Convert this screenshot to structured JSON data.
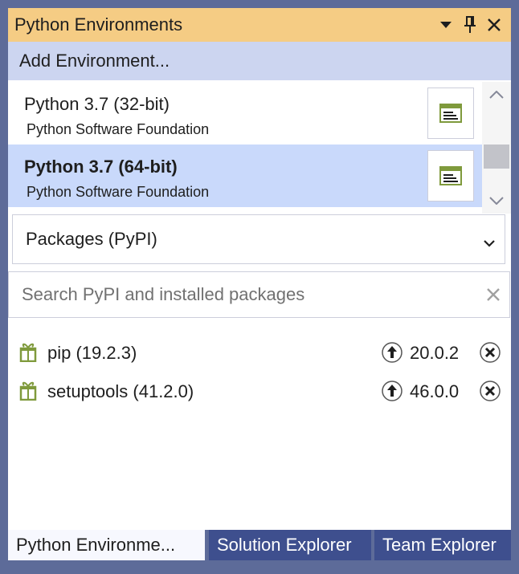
{
  "window": {
    "title": "Python Environments",
    "dropdown_icon": "triangle-down-icon",
    "pin_icon": "pin-icon",
    "close_icon": "close-icon"
  },
  "add_environment": {
    "label": "Add Environment..."
  },
  "environments": [
    {
      "name": "Python 3.7 (32-bit)",
      "vendor": "Python Software Foundation",
      "selected": false
    },
    {
      "name": "Python 3.7 (64-bit)",
      "vendor": "Python Software Foundation",
      "selected": true
    }
  ],
  "package_source": {
    "selected": "Packages (PyPI)"
  },
  "search": {
    "placeholder": "Search PyPI and installed packages",
    "value": ""
  },
  "packages": [
    {
      "name": "pip (19.2.3)",
      "latest": "20.0.2"
    },
    {
      "name": "setuptools (41.2.0)",
      "latest": "46.0.0"
    }
  ],
  "tabs": [
    {
      "label": "Python Environme...",
      "active": true
    },
    {
      "label": "Solution Explorer",
      "active": false
    },
    {
      "label": "Team Explorer",
      "active": false
    }
  ],
  "colors": {
    "title_bar": "#f5cc84",
    "add_env_bar": "#ccd5f0",
    "selected_row": "#c9d9fb",
    "frame": "#5d6b99",
    "inactive_tab": "#3e4f8e",
    "package_icon": "#7f9a3c"
  }
}
